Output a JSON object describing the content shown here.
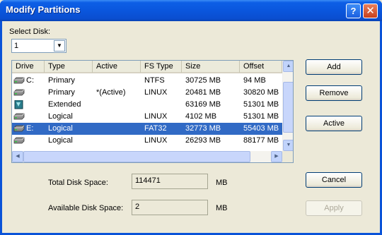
{
  "window": {
    "title": "Modify Partitions",
    "help_glyph": "?",
    "close_glyph": "✕"
  },
  "select_disk": {
    "label": "Select Disk:",
    "value": "1"
  },
  "table": {
    "columns": [
      "Drive",
      "Type",
      "Active",
      "FS Type",
      "Size",
      "Offset"
    ],
    "rows": [
      {
        "drive": "C:",
        "type": "Primary",
        "active": "",
        "fs": "NTFS",
        "size": "30725 MB",
        "offset": "94 MB",
        "icon": "hard-disk-icon",
        "selected": false
      },
      {
        "drive": "",
        "type": "Primary",
        "active": "*(Active)",
        "fs": "LINUX",
        "size": "20481 MB",
        "offset": "30820 MB",
        "icon": "hard-disk-icon",
        "selected": false
      },
      {
        "drive": "",
        "type": "Extended",
        "active": "",
        "fs": "",
        "size": "63169 MB",
        "offset": "51301 MB",
        "icon": "extended-partition-icon",
        "selected": false
      },
      {
        "drive": "",
        "type": "Logical",
        "active": "",
        "fs": "LINUX",
        "size": "4102 MB",
        "offset": "51301 MB",
        "icon": "hard-disk-icon",
        "selected": false
      },
      {
        "drive": "E:",
        "type": "Logical",
        "active": "",
        "fs": "FAT32",
        "size": "32773 MB",
        "offset": "55403 MB",
        "icon": "hard-disk-icon",
        "selected": true
      },
      {
        "drive": "",
        "type": "Logical",
        "active": "",
        "fs": "LINUX",
        "size": "26293 MB",
        "offset": "88177 MB",
        "icon": "hard-disk-icon",
        "selected": false
      }
    ]
  },
  "buttons": {
    "add": "Add",
    "remove": "Remove",
    "active": "Active",
    "cancel": "Cancel",
    "apply": "Apply"
  },
  "total_space": {
    "label": "Total Disk Space:",
    "value": "114471",
    "unit": "MB"
  },
  "available_space": {
    "label": "Available Disk Space:",
    "value": "2",
    "unit": "MB"
  },
  "colors": {
    "selection": "#316ac5",
    "titlebar": "#0a56dd",
    "dialog_bg": "#ece9d8"
  }
}
